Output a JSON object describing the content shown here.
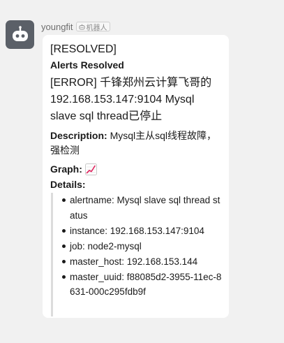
{
  "message": {
    "sender_name": "youngfit",
    "bot_badge": "机器人",
    "lines": {
      "resolved": "[RESOLVED]",
      "alerts_resolved": "Alerts Resolved",
      "error_title": "[ERROR] 千锋郑州云计算飞哥的192.168.153.147:9104 Mysql slave sql thread已停止"
    },
    "description": {
      "key": "Description:",
      "value": " Mysql主从sql线程故障，强检测"
    },
    "graph": {
      "key": "Graph:"
    },
    "details": {
      "title": "Details:",
      "items": [
        {
          "key": "alertname",
          "value": "alertname: Mysql slave sql thread status"
        },
        {
          "key": "instance",
          "value": "instance: 192.168.153.147:9104"
        },
        {
          "key": "job",
          "value": "job: node2-mysql"
        },
        {
          "key": "master_host",
          "value": "master_host: 192.168.153.144"
        },
        {
          "key": "master_uuid",
          "value": "master_uuid: f88085d2-3955-11ec-8631-000c295fdb9f"
        }
      ]
    }
  },
  "icons": {
    "avatar": "robot-icon",
    "badge": "robot-badge-icon",
    "graph": "chart-increasing-icon"
  }
}
